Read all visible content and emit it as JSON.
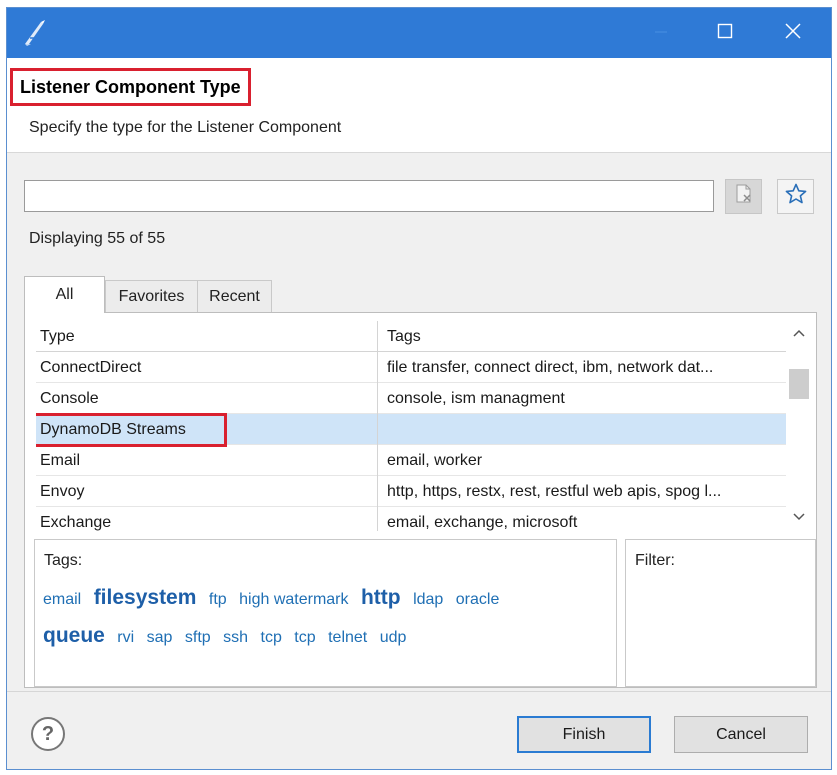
{
  "titlebar": {
    "app_icon": "quill-pen-icon",
    "minimize_icon": "minimize-icon",
    "maximize_icon": "maximize-icon",
    "close_icon": "close-icon"
  },
  "header": {
    "title": "Listener Component Type",
    "subtitle": "Specify the type for the Listener Component"
  },
  "filter": {
    "value": "",
    "placeholder": "",
    "clear_icon": "clear-filter-icon",
    "favorite_icon": "star-icon"
  },
  "status": {
    "displaying": "Displaying 55 of 55"
  },
  "tabs": [
    {
      "label": "All",
      "active": true
    },
    {
      "label": "Favorites",
      "active": false
    },
    {
      "label": "Recent",
      "active": false
    }
  ],
  "table": {
    "columns": [
      "Type",
      "Tags"
    ],
    "rows": [
      {
        "type": "ConnectDirect",
        "tags": "file transfer, connect direct, ibm, network dat..."
      },
      {
        "type": "Console",
        "tags": "console, ism managment"
      },
      {
        "type": "DynamoDB Streams",
        "tags": "",
        "selected": true
      },
      {
        "type": "Email",
        "tags": "email, worker"
      },
      {
        "type": "Envoy",
        "tags": "http, https, restx, rest, restful web apis, spog l..."
      },
      {
        "type": "Exchange",
        "tags": "email, exchange, microsoft"
      }
    ]
  },
  "tags_panel": {
    "label": "Tags:",
    "tags": [
      {
        "text": "email",
        "big": false
      },
      {
        "text": "filesystem",
        "big": true
      },
      {
        "text": "ftp",
        "big": false
      },
      {
        "text": "high watermark",
        "big": false
      },
      {
        "text": "http",
        "big": true
      },
      {
        "text": "ldap",
        "big": false
      },
      {
        "text": "oracle",
        "big": false
      },
      {
        "text": "queue",
        "big": true
      },
      {
        "text": "rvi",
        "big": false
      },
      {
        "text": "sap",
        "big": false
      },
      {
        "text": "sftp",
        "big": false
      },
      {
        "text": "ssh",
        "big": false
      },
      {
        "text": "tcp",
        "big": false
      },
      {
        "text": "tcp",
        "big": false
      },
      {
        "text": "telnet",
        "big": false
      },
      {
        "text": "udp",
        "big": false
      }
    ]
  },
  "filter_panel": {
    "label": "Filter:"
  },
  "footer": {
    "help_label": "?",
    "finish_label": "Finish",
    "cancel_label": "Cancel"
  },
  "colors": {
    "titlebar": "#2f7ad6",
    "annotation": "#d9202f",
    "selection": "#cfe4f8",
    "tag_link": "#1f6fb4"
  }
}
